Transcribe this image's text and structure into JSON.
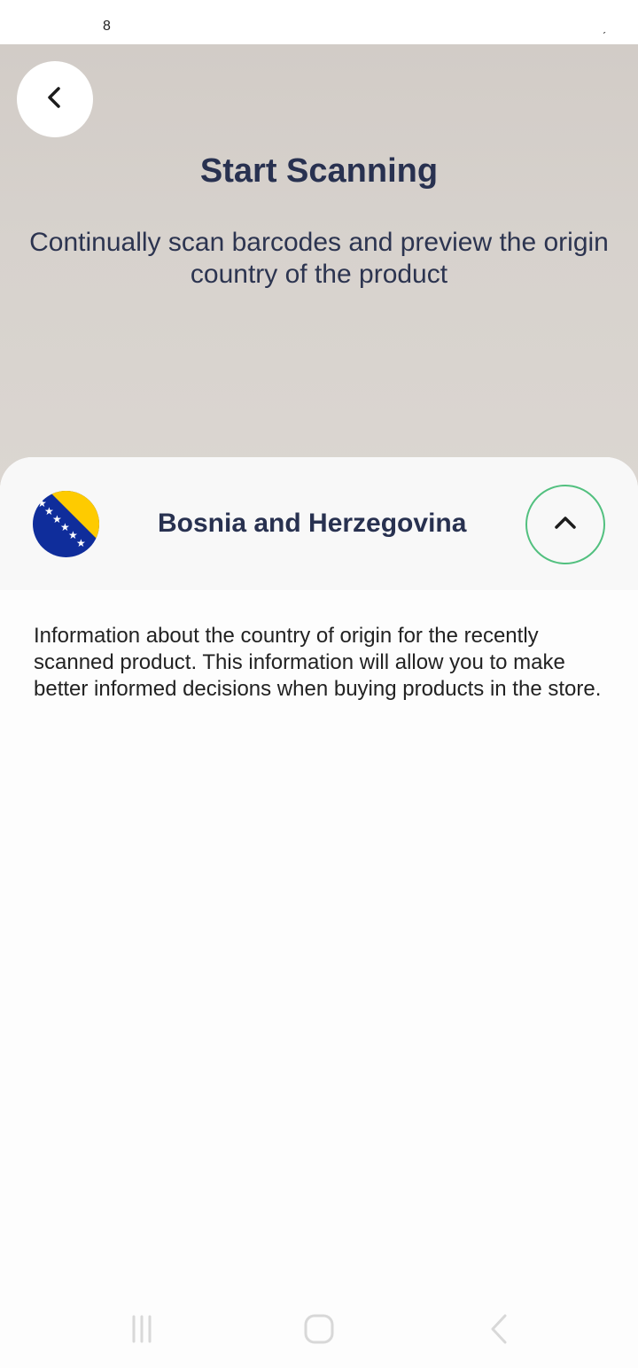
{
  "status_bar": {
    "time": "8",
    "right_glyph": "ˏ"
  },
  "header": {
    "back_icon": "chevron-left-icon",
    "title": "Start Scanning",
    "subtitle": "Continually scan barcodes and preview the origin country of the product"
  },
  "result": {
    "flag_icon": "bosnia-flag-icon",
    "country": "Bosnia and Herzegovina",
    "expand_icon": "chevron-up-icon",
    "description": "Information about the country of origin for the recently scanned product. This information will allow you to make better informed decisions when buying products in the store."
  },
  "nav": {
    "recents_icon": "recents-icon",
    "home_icon": "home-icon",
    "back_icon": "back-icon"
  },
  "colors": {
    "title": "#283150",
    "accent_ring": "#52c07f",
    "flag_blue": "#0f2d9b",
    "flag_yellow": "#fecb00"
  }
}
